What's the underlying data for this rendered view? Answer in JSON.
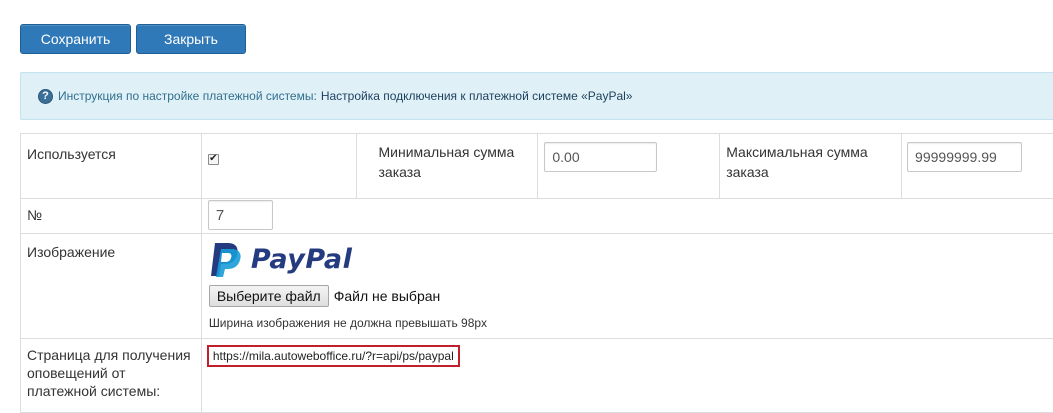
{
  "toolbar": {
    "save_label": "Сохранить",
    "close_label": "Закрыть"
  },
  "info": {
    "icon": "question-circle-icon",
    "text": "Инструкция по настройке платежной системы:",
    "link_text": "Настройка подключения к платежной системе «PayPal»"
  },
  "form": {
    "used": {
      "label": "Используется",
      "checked": true
    },
    "min_amount": {
      "label": "Минимальная сумма заказа",
      "value": "0.00"
    },
    "max_amount": {
      "label": "Максимальная сумма заказа",
      "value": "99999999.99"
    },
    "number": {
      "label": "№",
      "value": "7"
    },
    "image": {
      "label": "Изображение",
      "logo_text": "PayPal",
      "file_button": "Выберите файл",
      "file_status": "Файл не выбран",
      "hint": "Ширина изображения не должна превышать 98px"
    },
    "notify": {
      "label": "Страница для получения оповещений от платежной системы:",
      "url": "https://mila.autoweboffice.ru/?r=api/ps/paypal"
    }
  },
  "colors": {
    "button": "#3079b8",
    "info_bg": "#dff0f6",
    "highlight_border": "#c0202b",
    "paypal_dark": "#253b80",
    "paypal_light": "#179bd7"
  }
}
